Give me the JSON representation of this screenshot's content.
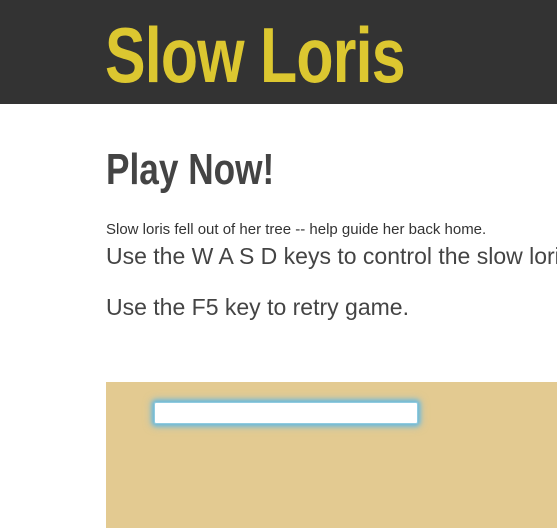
{
  "header": {
    "title": "Slow Loris"
  },
  "main": {
    "heading": "Play Now!",
    "intro": "Slow loris fell out of her tree -- help guide her back home.",
    "instructions": [
      "Use the W A S D keys to control the slow loris.",
      "Use the F5 key to retry game."
    ]
  },
  "game": {
    "background_color": "#e3ca91",
    "platform_color": "#ffffff",
    "platform_glow_color": "#69b9dd"
  },
  "colors": {
    "header_background": "#333333",
    "title_yellow": "#dcc730",
    "heading_gray": "#444444"
  }
}
